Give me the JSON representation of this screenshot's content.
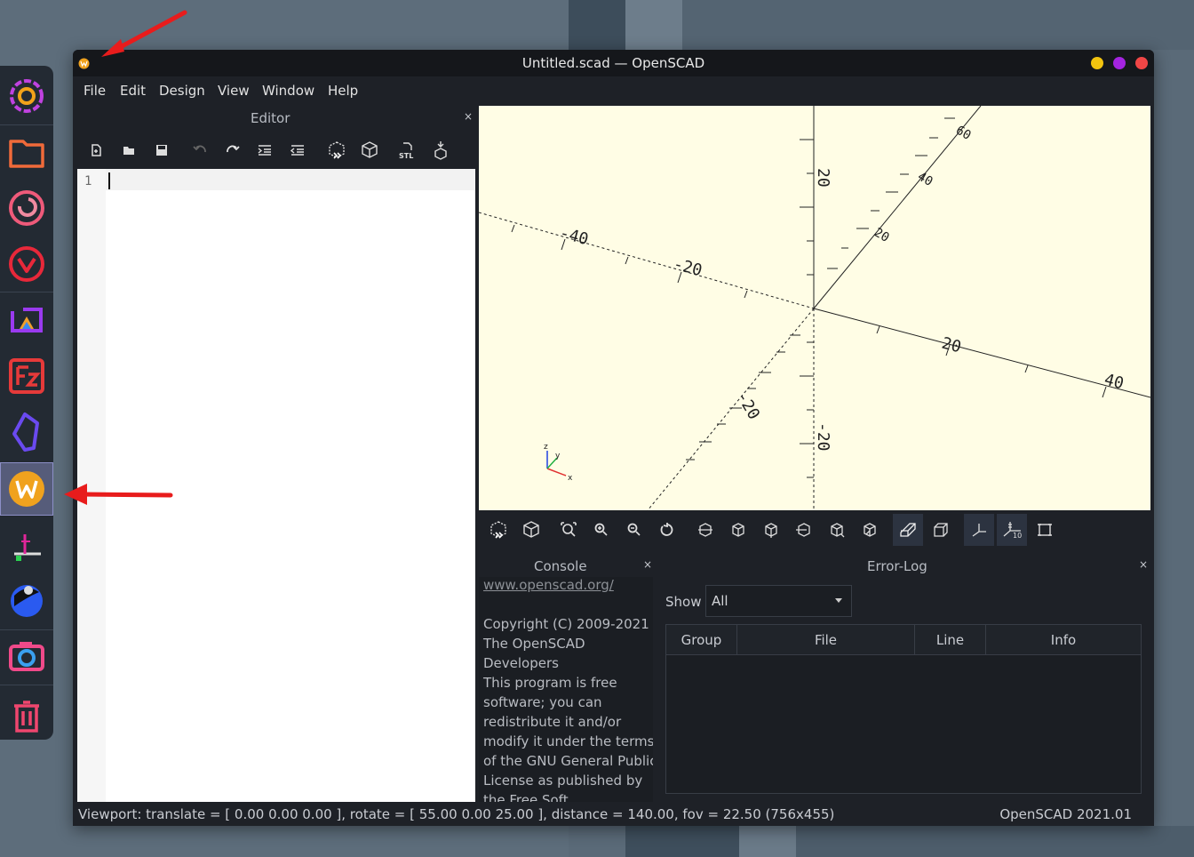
{
  "window": {
    "title": "Untitled.scad — OpenSCAD",
    "buttons": [
      "minimize",
      "maximize",
      "close"
    ],
    "button_colors": [
      "#f2c40f",
      "#a424e0",
      "#f04646"
    ]
  },
  "menu": [
    "File",
    "Edit",
    "Design",
    "View",
    "Window",
    "Help"
  ],
  "editor": {
    "title": "Editor",
    "close": "×",
    "line_number": "1",
    "toolbar": [
      "new-file-icon",
      "open-file-icon",
      "save-icon",
      "undo-icon",
      "redo-icon",
      "indent-icon",
      "unindent-icon",
      "preview-icon",
      "render-icon",
      "export-stl-icon",
      "send-to-print-icon"
    ],
    "stl_label": "STL"
  },
  "viewport": {
    "background": "#fffde5",
    "axis_labels": {
      "x_pos_20": "20",
      "x_pos_40": "40",
      "x_neg_20": "-20",
      "x_neg_40": "-40",
      "y_pos_20": "20",
      "y_pos_40": "40",
      "y_pos_60": "60",
      "y_neg_20": "-20",
      "z_pos_20": "20",
      "z_neg_20": "-20"
    },
    "gizmo": {
      "x": "x",
      "y": "y",
      "z": "z"
    }
  },
  "viewport_toolbar": [
    "preview-icon",
    "render-icon",
    "view-all-icon",
    "zoom-in-icon",
    "zoom-out-icon",
    "reset-view-icon",
    "view-right-icon",
    "view-top-icon",
    "view-bottom-icon",
    "view-left-icon",
    "view-front-icon",
    "view-back-icon",
    "perspective-icon",
    "orthogonal-icon",
    "show-axes-icon",
    "show-scale-markers-icon",
    "show-edges-icon"
  ],
  "console": {
    "title": "Console",
    "close": "×",
    "link": "www.openscad.org/",
    "lines": [
      "Copyright (C) 2009-2021",
      "The OpenSCAD",
      "Developers",
      "This program is free",
      "software; you can",
      "redistribute it and/or",
      "modify it under the terms",
      "of the GNU General Public",
      "License as published by",
      "the Free Soft..."
    ]
  },
  "error_log": {
    "title": "Error-Log",
    "close": "×",
    "show_label": "Show",
    "filter": "All",
    "columns": [
      "Group",
      "File",
      "Line",
      "Info"
    ]
  },
  "status": {
    "viewport": "Viewport: translate = [ 0.00 0.00 0.00 ], rotate = [ 55.00 0.00 25.00 ], distance = 140.00, fov = 22.50 (756x455)",
    "version": "OpenSCAD 2021.01"
  },
  "dock": {
    "items": [
      "settings-app-icon",
      "files-app-icon",
      "firefox-app-icon",
      "vivaldi-app-icon",
      "photo-editor-app-icon",
      "filezilla-app-icon",
      "obsidian-app-icon",
      "wallpaper-app-icon",
      "axis-tool-app-icon",
      "launcher-app-icon",
      "screenshot-app-icon",
      "trash-app-icon"
    ]
  },
  "annotations": [
    "red-arrow",
    "red-arrow"
  ]
}
